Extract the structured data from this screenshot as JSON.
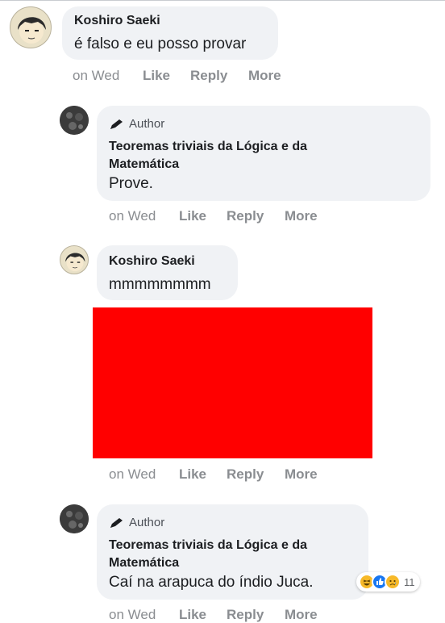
{
  "comments": [
    {
      "author": "Koshiro Saeki",
      "text": "é falso e eu posso provar",
      "actions": {
        "time": "on Wed",
        "like": "Like",
        "reply": "Reply",
        "more": "More"
      }
    },
    {
      "badge": "Author",
      "author": "Teoremas triviais da Lógica e da Matemática",
      "text": "Prove.",
      "actions": {
        "time": "on Wed",
        "like": "Like",
        "reply": "Reply",
        "more": "More"
      }
    },
    {
      "author": "Koshiro Saeki",
      "text": "mmmmmmmm",
      "actions": {
        "time": "on Wed",
        "like": "Like",
        "reply": "Reply",
        "more": "More"
      }
    },
    {
      "badge": "Author",
      "author": "Teoremas triviais da Lógica e da Matemática",
      "text": "Caí na arapuca do índio Juca.",
      "reactions": {
        "icons": [
          "haha-icon",
          "like-icon",
          "sad-icon"
        ],
        "count": "11"
      },
      "actions": {
        "time": "on Wed",
        "like": "Like",
        "reply": "Reply",
        "more": "More"
      }
    }
  ],
  "colors": {
    "bubble": "#f0f2f5",
    "meta": "#8a8d91",
    "image_block": "#ff0000",
    "like": "#1877f2"
  }
}
